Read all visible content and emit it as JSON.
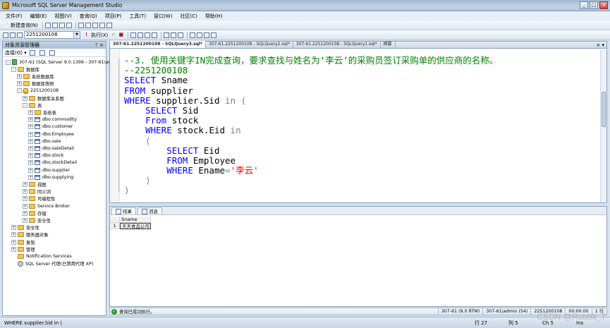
{
  "window": {
    "title": "Microsoft SQL Server Management Studio",
    "controls": [
      "_",
      "□",
      "×"
    ]
  },
  "menu": [
    "文件(F)",
    "编辑(E)",
    "视图(V)",
    "查询(Q)",
    "项目(P)",
    "工具(T)",
    "窗口(W)",
    "社区(C)",
    "帮助(H)"
  ],
  "toolbar1": {
    "new_query": "新建查询(N)"
  },
  "toolbar2": {
    "database": "2251200108",
    "execute": "执行(X)"
  },
  "explorer": {
    "title": "对象资源管理器",
    "connect": "连接(O) ▾",
    "nodes": [
      {
        "label": "307-61 (SQL Server 9.0.1399 - 307-61\\ad",
        "exp": "-",
        "icon": "server"
      },
      {
        "label": "数据库",
        "exp": "-",
        "icon": "folder"
      },
      {
        "label": "系统数据库",
        "exp": "+",
        "icon": "folder"
      },
      {
        "label": "数据库快照",
        "exp": "+",
        "icon": "folder"
      },
      {
        "label": "2251200108",
        "exp": "-",
        "icon": "db"
      },
      {
        "label": "数据库关系图",
        "exp": "+",
        "icon": "folder"
      },
      {
        "label": "表",
        "exp": "-",
        "icon": "folder"
      },
      {
        "label": "系统表",
        "exp": "+",
        "icon": "folder"
      },
      {
        "label": "dbo.commodity",
        "exp": "+",
        "icon": "table"
      },
      {
        "label": "dbo.customer",
        "exp": "+",
        "icon": "table"
      },
      {
        "label": "dbo.Employee",
        "exp": "+",
        "icon": "table"
      },
      {
        "label": "dbo.sale",
        "exp": "+",
        "icon": "table"
      },
      {
        "label": "dbo.saleDetail",
        "exp": "+",
        "icon": "table"
      },
      {
        "label": "dbo.stock",
        "exp": "+",
        "icon": "table"
      },
      {
        "label": "dbo.stockDetail",
        "exp": "+",
        "icon": "table"
      },
      {
        "label": "dbo.supplier",
        "exp": "+",
        "icon": "table"
      },
      {
        "label": "dbo.supplying",
        "exp": "+",
        "icon": "table"
      },
      {
        "label": "视图",
        "exp": "+",
        "icon": "folder"
      },
      {
        "label": "同义词",
        "exp": "+",
        "icon": "folder"
      },
      {
        "label": "可编程性",
        "exp": "+",
        "icon": "folder"
      },
      {
        "label": "Service Broker",
        "exp": "+",
        "icon": "folder"
      },
      {
        "label": "存储",
        "exp": "+",
        "icon": "folder"
      },
      {
        "label": "安全性",
        "exp": "+",
        "icon": "folder"
      },
      {
        "label": "安全性",
        "exp": "+",
        "icon": "folder"
      },
      {
        "label": "服务器对象",
        "exp": "+",
        "icon": "folder"
      },
      {
        "label": "复制",
        "exp": "+",
        "icon": "folder"
      },
      {
        "label": "管理",
        "exp": "+",
        "icon": "folder"
      },
      {
        "label": "Notification Services",
        "exp": "",
        "icon": "folder"
      },
      {
        "label": "SQL Server 代理(已禁用代理 XP)",
        "exp": "",
        "icon": "agent"
      }
    ]
  },
  "editor": {
    "tabs": [
      "307-61.2251200108 - SQLQuery3.sql*",
      "307-61.2251200108 - SQLQuery2.sql*",
      "307-61.2251200108 - SQLQuery1.sql*",
      "摘要"
    ],
    "code": {
      "l1": "--3. 使用关键字IN完成查询，要求查找与姓名为‘李云’的采购员签订采购单的供应商的名称。",
      "l2": "--2251200108",
      "l3_kw": "SELECT",
      "l3_id": " Sname",
      "l4_kw": "FROM",
      "l4_id": " supplier",
      "l5_kw": "WHERE",
      "l5_id": " supplier.Sid ",
      "l5_in": "in",
      "l5_paren": " (",
      "l6_kw": "SELECT",
      "l6_id": " Sid",
      "l7_kw": "From",
      "l7_id": " stock",
      "l8_kw": "WHERE",
      "l8_id": " stock.Eid ",
      "l8_in": "in",
      "l9": "(",
      "l10_kw": "SELECT",
      "l10_id": " Eid",
      "l11_kw": "FROM",
      "l11_id": " Employee",
      "l12_kw": "WHERE",
      "l12_id": " Ename",
      "l12_eq": "=",
      "l12_str": "'李云'",
      "l13": ")",
      "l14": ")"
    }
  },
  "results": {
    "tabs": [
      "结果",
      "消息"
    ],
    "columns": [
      "Sname"
    ],
    "rows": [
      [
        "1",
        "天天食品公司"
      ]
    ]
  },
  "status": {
    "message": "查询已成功执行。",
    "server": "307-61 (9.0 RTM)",
    "user": "307-61\\admin (54)",
    "database": "2251200108",
    "time": "00:00:00",
    "rows": "1 行"
  },
  "bottombar": {
    "left": "WHERE supplier.Sid in (",
    "line": "行 27",
    "col": "列 5",
    "ch": "Ch 5",
    "ins": "Ins"
  },
  "watermark": "CSDN @Rabbit_7"
}
